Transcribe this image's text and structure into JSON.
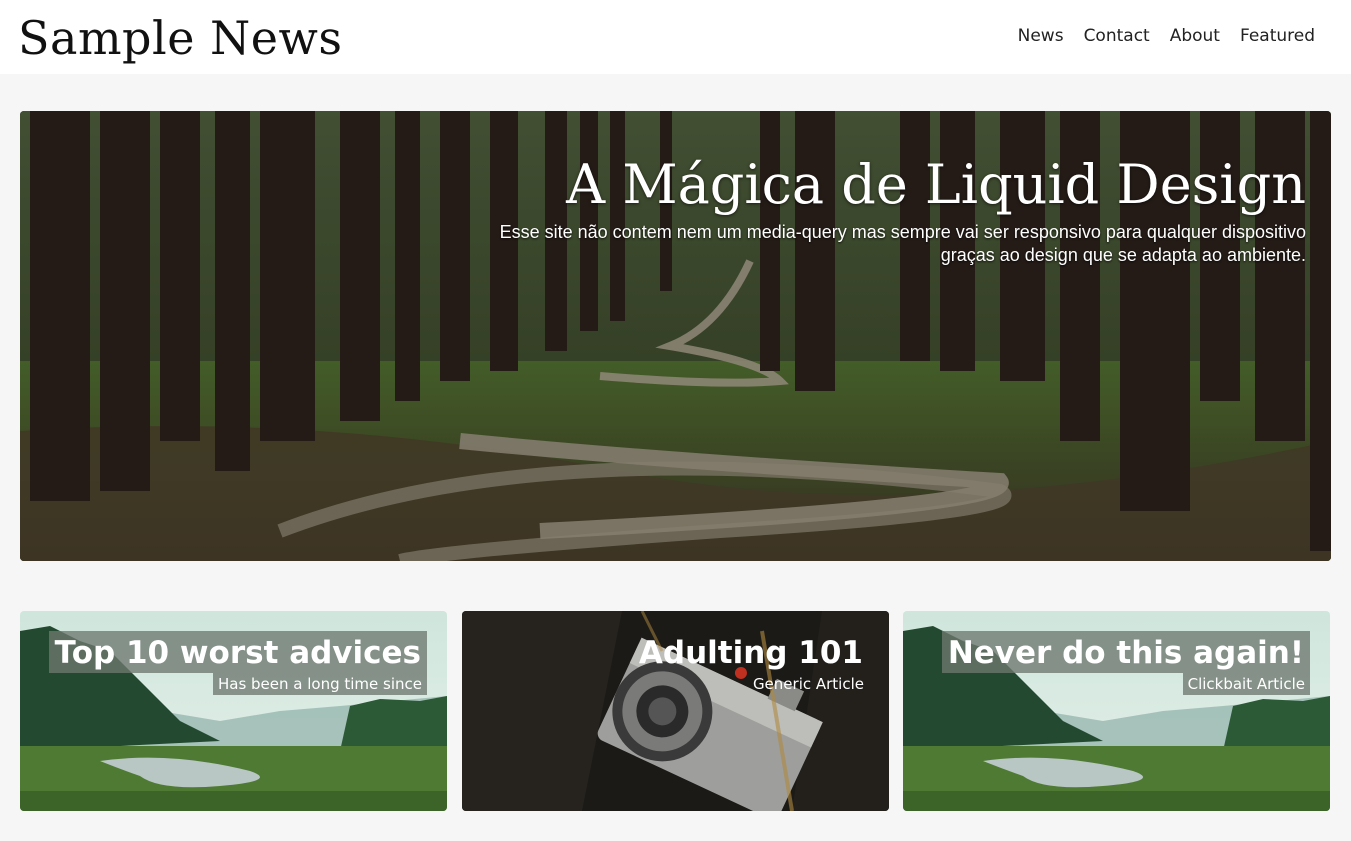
{
  "header": {
    "site_title": "Sample News",
    "nav": [
      "News",
      "Contact",
      "About",
      "Featured"
    ]
  },
  "hero": {
    "title": "A Mágica de Liquid Design",
    "subtitle": "Esse site não contem nem um media-query mas sempre vai ser responsivo para qualquer dispositivo graças ao design que se adapta ao ambiente."
  },
  "cards": [
    {
      "title": "Top 10 worst advices",
      "subtitle": "Has been a long time since"
    },
    {
      "title": "Adulting 101",
      "subtitle": "Generic Article"
    },
    {
      "title": "Never do this again!",
      "subtitle": "Clickbait Article"
    }
  ],
  "colors": {
    "header_bg": "#ffffff",
    "page_bg": "#f6f6f6",
    "text_dark": "#111111"
  }
}
